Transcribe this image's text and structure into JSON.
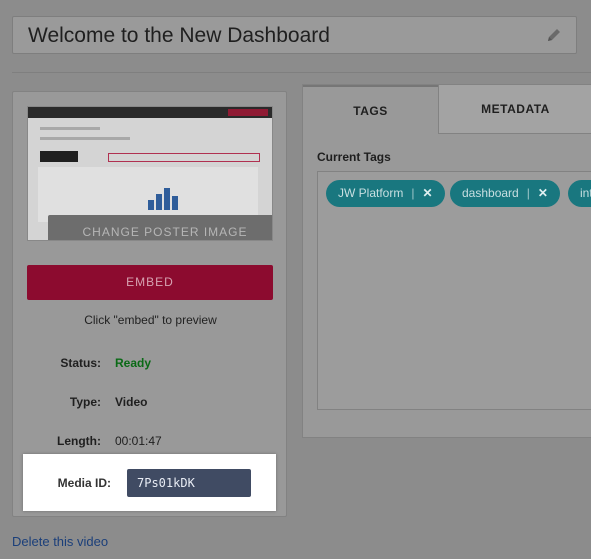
{
  "header": {
    "title": "Welcome to the New Dashboard",
    "edit_icon": "pencil-icon"
  },
  "preview": {
    "change_poster_label": "CHANGE POSTER IMAGE",
    "embed_label": "EMBED",
    "embed_hint": "Click \"embed\" to preview"
  },
  "details": {
    "status_label": "Status:",
    "status_value": "Ready",
    "type_label": "Type:",
    "type_value": "Video",
    "length_label": "Length:",
    "length_value": "00:01:47",
    "media_id_label": "Media ID:",
    "media_id_value": "7Ps01kDK"
  },
  "delete_link": "Delete this video",
  "tabs": [
    {
      "label": "TAGS",
      "active": true
    },
    {
      "label": "METADATA",
      "active": false
    }
  ],
  "tags_section": {
    "heading": "Current Tags",
    "tags": [
      {
        "label": "JW Platform",
        "remove_icon": "close-icon"
      },
      {
        "label": "dashboard",
        "remove_icon": "close-icon"
      },
      {
        "label": "intr",
        "remove_icon": "close-icon"
      }
    ],
    "separator": "|",
    "remove_glyph": "✕"
  },
  "colors": {
    "overlay": "#8c8c8c",
    "embed_button": "#8c0b2f",
    "tag_chip": "#19777f",
    "status_ready": "#0a6a16",
    "media_id_field": "#404b63",
    "link": "#1b3f7a"
  }
}
